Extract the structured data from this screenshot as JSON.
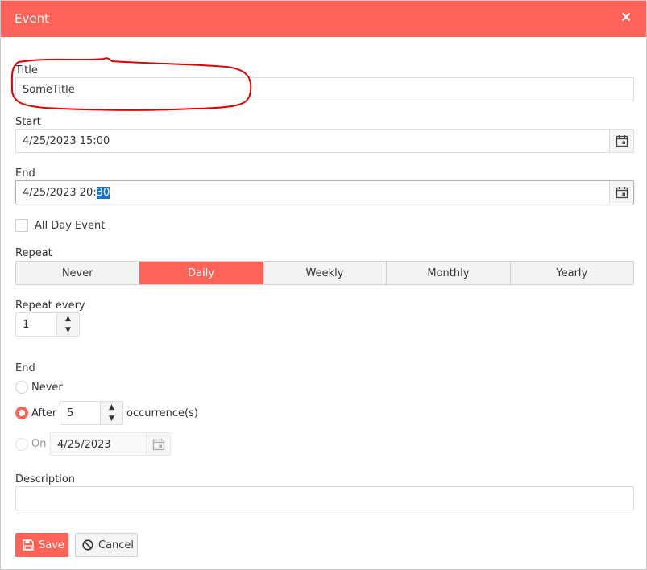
{
  "window": {
    "title": "Event",
    "close_icon": "close-icon"
  },
  "title_field": {
    "label": "Title",
    "value": "SomeTitle"
  },
  "start_field": {
    "label": "Start",
    "value": "4/25/2023 15:00",
    "icon": "calendar-icon"
  },
  "end_field": {
    "label": "End",
    "value_prefix": "4/25/2023 20:",
    "value_selected": "30",
    "icon": "calendar-icon"
  },
  "all_day": {
    "label": "All Day Event",
    "checked": false
  },
  "repeat": {
    "label": "Repeat",
    "options": [
      "Never",
      "Daily",
      "Weekly",
      "Monthly",
      "Yearly"
    ],
    "selected": "Daily"
  },
  "repeat_every": {
    "label": "Repeat every",
    "value": "1"
  },
  "end_rule": {
    "label": "End",
    "never_label": "Never",
    "after_label": "After",
    "after_value": "5",
    "after_suffix": "occurrence(s)",
    "on_label": "On",
    "on_value": "4/25/2023",
    "selected": "After"
  },
  "description": {
    "label": "Description",
    "value": ""
  },
  "actions": {
    "save_label": "Save",
    "cancel_label": "Cancel"
  },
  "colors": {
    "accent": "#ff6358",
    "annotation": "#e00000",
    "selection": "#1a73c7"
  }
}
